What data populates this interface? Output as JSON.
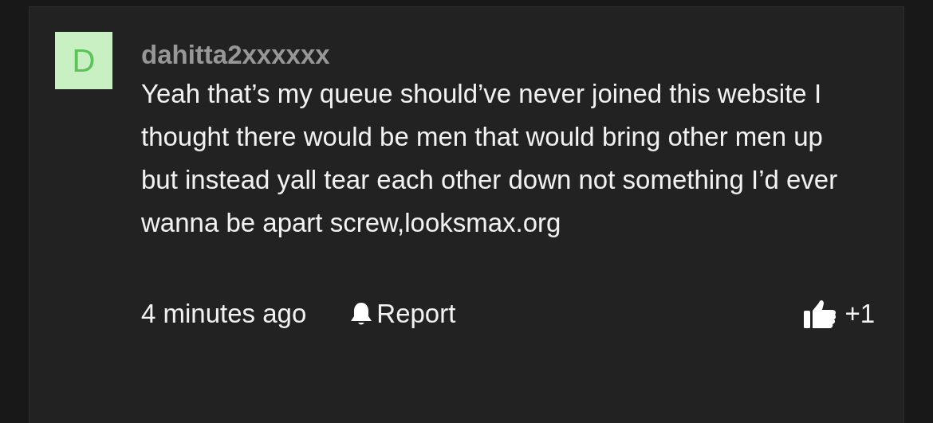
{
  "comment": {
    "avatar_letter": "D",
    "author": "dahitta2xxxxxx",
    "text": "Yeah that’s my queue should’ve never joined this website I thought there would be men that would bring other men up but instead yall tear each other down not something I’d ever wanna be apart screw,looksmax.org",
    "time": "4 minutes ago",
    "report": "Report",
    "likes": "+1"
  }
}
